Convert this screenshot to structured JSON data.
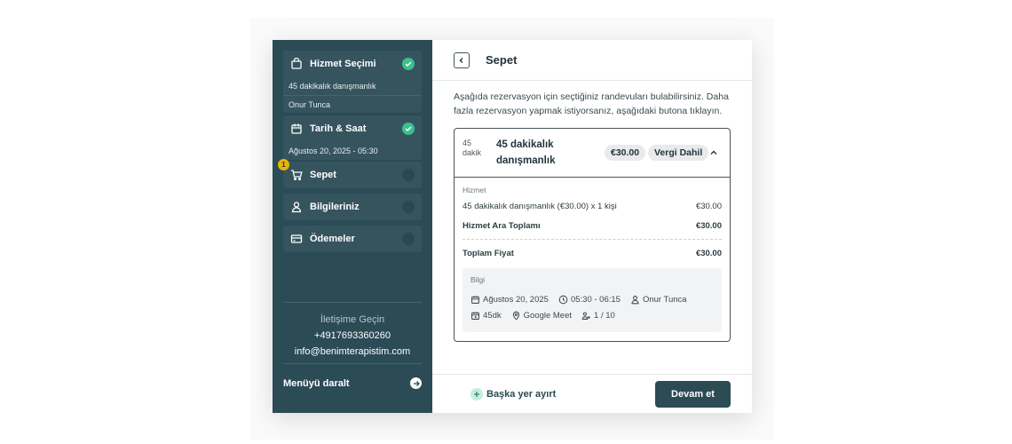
{
  "steps": [
    {
      "title": "Hizmet Seçimi",
      "sub1": "45 dakikalık danışmanlık",
      "sub2": "Onur Tunca",
      "done": true
    },
    {
      "title": "Tarih & Saat",
      "sub1": "Ağustos 20, 2025 - 05:30",
      "done": true
    },
    {
      "title": "Sepet",
      "badge": "1",
      "done": false
    },
    {
      "title": "Bilgileriniz",
      "done": false
    },
    {
      "title": "Ödemeler",
      "done": false
    }
  ],
  "contact": {
    "heading": "İletişime Geçin",
    "phone": "+4917693360260",
    "email": "info@benimterapistim.com"
  },
  "collapse_label": "Menüyü daralt",
  "header": {
    "title": "Sepet"
  },
  "intro": "Aşağıda rezervasyon için seçtiğiniz randevuları bulabilirsiniz. Daha fazla rezervasyon yapmak istiyorsanız, aşağıdaki butona tıklayın.",
  "cart": {
    "thumb_alt": "45 dakik",
    "service": "45 dakikalık danışmanlık",
    "price": "€30.00",
    "tax": "Vergi Dahil",
    "section": "Hizmet",
    "line": {
      "label": "45 dakikalık danışmanlık (€30.00) x 1 kişi",
      "value": "€30.00"
    },
    "subtotal": {
      "label": "Hizmet Ara Toplamı",
      "value": "€30.00"
    },
    "total": {
      "label": "Toplam Fiyat",
      "value": "€30.00"
    },
    "info": {
      "label": "Bilgi",
      "date": "Ağustos 20, 2025",
      "time": "05:30 - 06:15",
      "person": "Onur Tunca",
      "duration": "45dk",
      "location": "Google Meet",
      "capacity": "1 / 10"
    }
  },
  "footer": {
    "add_label": "Başka yer ayırt",
    "next_label": "Devam et"
  },
  "colors": {
    "sidebar": "#2b4b55",
    "accent": "#3cbf8f",
    "badge": "#e8b500"
  }
}
